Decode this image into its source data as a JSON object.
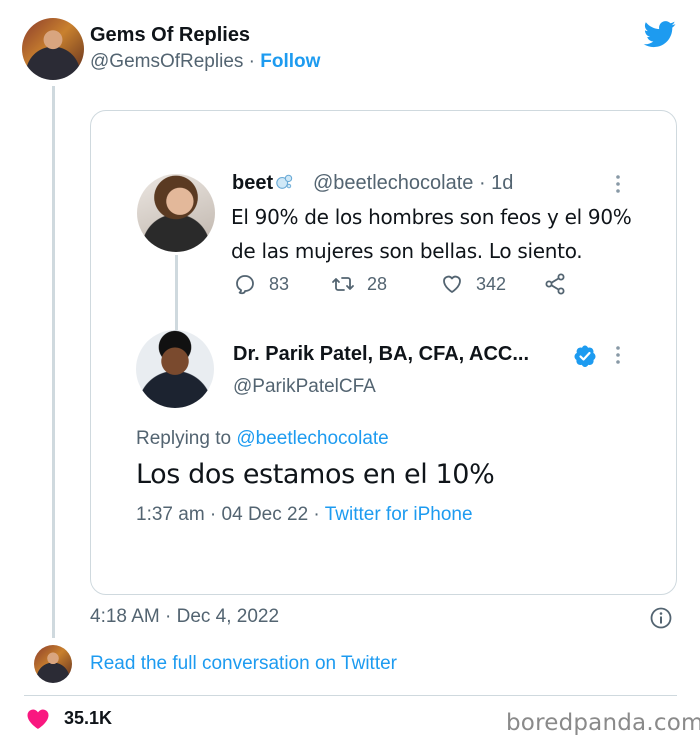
{
  "outer_tweet": {
    "display_name": "Gems Of Replies",
    "handle": "@GemsOfReplies",
    "separator": "·",
    "follow_label": "Follow",
    "timestamp": "4:18 AM · Dec 4, 2022",
    "read_full_label": "Read the full conversation on Twitter",
    "like_count": "35.1K"
  },
  "quoted_tweet": {
    "display_name": "beet",
    "handle_time": "@beetlechocolate · 1d",
    "text": "El 90% de los hombres son feos y el 90% de las mujeres son bellas. Lo siento.",
    "reply_count": "83",
    "retweet_count": "28",
    "like_count": "342"
  },
  "reply_tweet": {
    "display_name": "Dr. Parik Patel, BA, CFA, ACC...",
    "handle": "@ParikPatelCFA",
    "replying_prefix": "Replying to",
    "replying_to": "@beetlechocolate",
    "text": "Los dos estamos en el 10%",
    "time_date": "1:37 am · 04 Dec 22 ·",
    "source": "Twitter for iPhone"
  },
  "watermark": "boredpanda.com",
  "colors": {
    "brand_blue": "#1d9bf0",
    "secondary_text": "#536471",
    "border": "#cfd9de",
    "heart_pink": "#f91880"
  },
  "icons": [
    "twitter-bird-icon",
    "bubble-icon",
    "more-icon",
    "reply-icon",
    "retweet-icon",
    "like-icon",
    "share-icon",
    "verified-icon",
    "info-icon",
    "heart-icon"
  ]
}
